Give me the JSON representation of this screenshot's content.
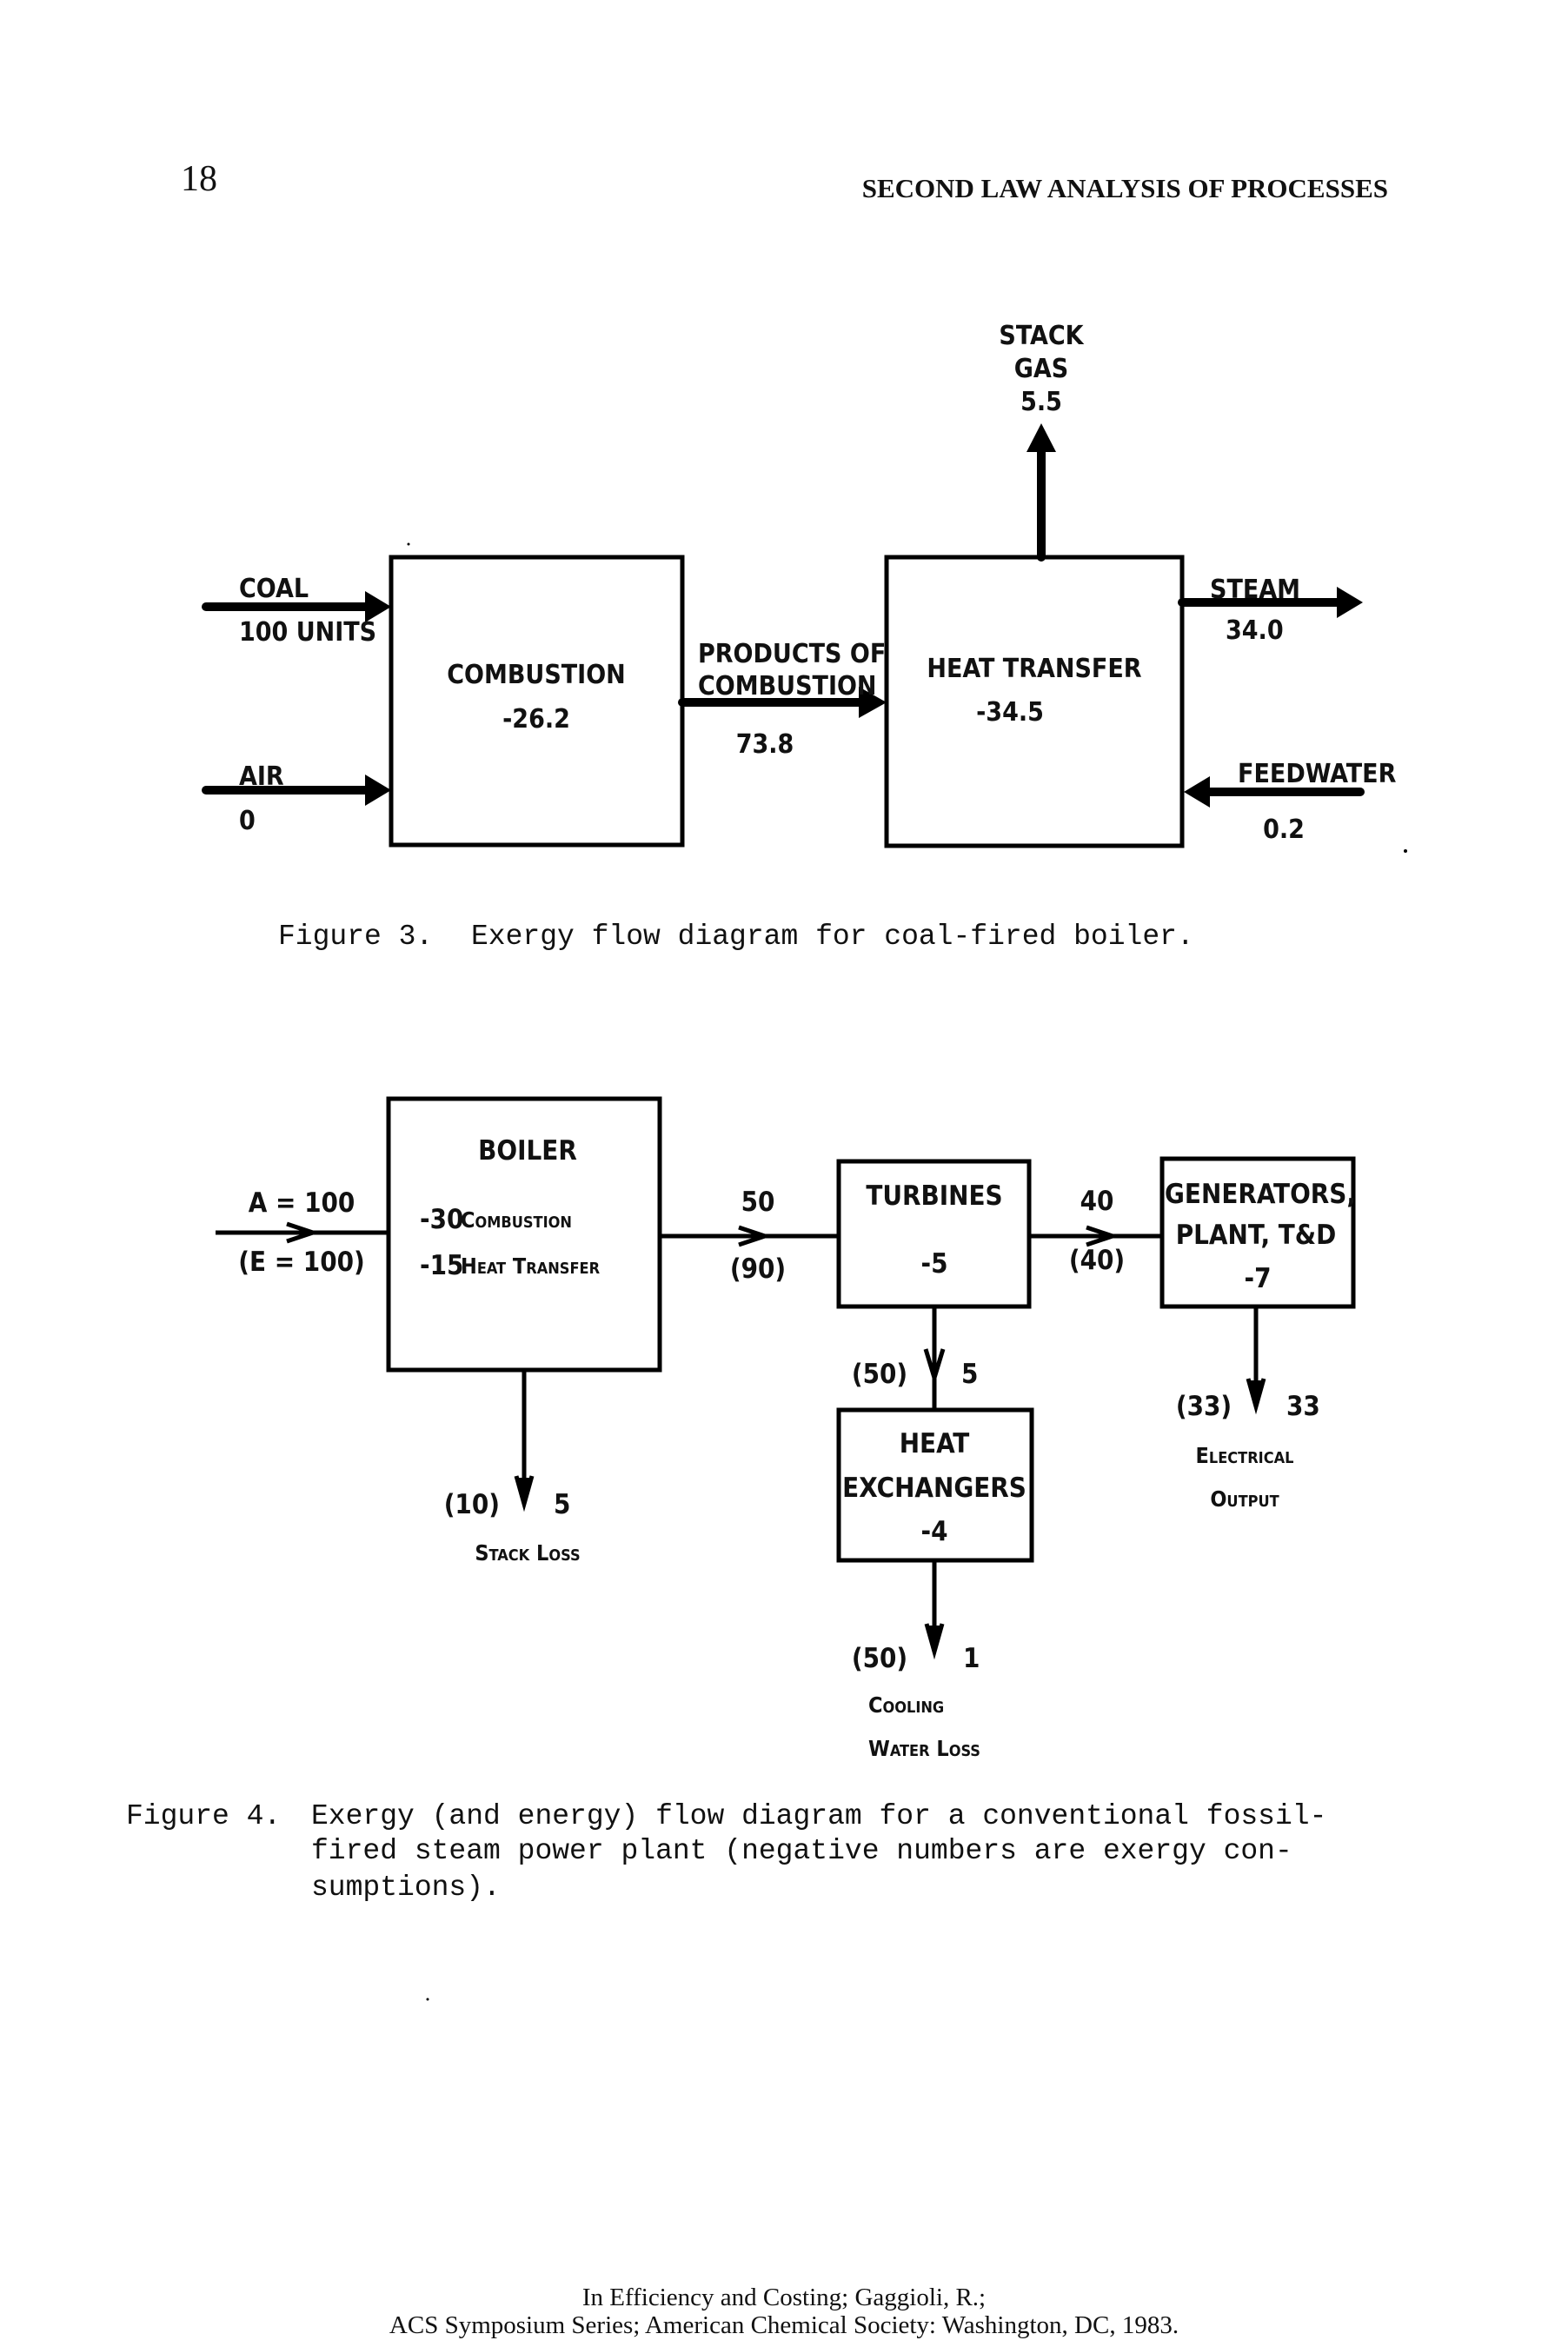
{
  "header": {
    "page_number": "18",
    "running_title": "SECOND LAW ANALYSIS OF PROCESSES"
  },
  "figure3": {
    "caption_label": "Figure 3.",
    "caption_text": "Exergy flow diagram for coal-fired boiler.",
    "inputs": {
      "coal_label": "COAL",
      "coal_value": "100 UNITS",
      "air_label": "AIR",
      "air_value": "0"
    },
    "combustion": {
      "title": "COMBUSTION",
      "value": "-26.2"
    },
    "products": {
      "line1": "PRODUCTS OF",
      "line2": "COMBUSTION",
      "value": "73.8"
    },
    "heat_transfer": {
      "title": "HEAT TRANSFER",
      "value": "-34.5"
    },
    "stack_gas": {
      "line1": "STACK",
      "line2": "GAS",
      "value": "5.5"
    },
    "steam": {
      "label": "STEAM",
      "value": "34.0"
    },
    "feedwater": {
      "label": "FEEDWATER",
      "value": "0.2"
    }
  },
  "figure4": {
    "caption_label": "Figure 4.",
    "caption_lines": [
      "Exergy (and energy) flow diagram for a conventional fossil-",
      "fired steam power plant (negative numbers are exergy con-",
      "sumptions)."
    ],
    "input": {
      "exergy": "A = 100",
      "energy": "(E = 100)"
    },
    "boiler": {
      "title": "BOILER",
      "line1_value": "-30",
      "line1_label": "Combustion",
      "line2_value": "-15",
      "line2_label": "Heat Transfer"
    },
    "boiler_to_turbines": {
      "exergy": "50",
      "energy": "(90)"
    },
    "stack_loss": {
      "energy": "(10)",
      "exergy": "5",
      "label": "Stack Loss"
    },
    "turbines": {
      "title": "TURBINES",
      "value": "-5"
    },
    "turbines_to_generators": {
      "exergy": "40",
      "energy": "(40)"
    },
    "turbines_to_hx": {
      "energy": "(50)",
      "exergy": "5"
    },
    "generators": {
      "line1": "GENERATORS,",
      "line2": "PLANT, T&D",
      "value": "-7"
    },
    "electrical_output": {
      "energy": "(33)",
      "exergy": "33",
      "line1": "Electrical",
      "line2": "Output"
    },
    "heat_exchangers": {
      "line1": "HEAT",
      "line2": "EXCHANGERS",
      "value": "-4"
    },
    "cooling_water": {
      "energy": "(50)",
      "exergy": "1",
      "line1": "Cooling",
      "line2": "Water Loss"
    }
  },
  "footer": {
    "line1": "In Efficiency and Costing; Gaggioli, R.;",
    "line2": "ACS Symposium Series; American Chemical Society: Washington, DC, 1983."
  }
}
